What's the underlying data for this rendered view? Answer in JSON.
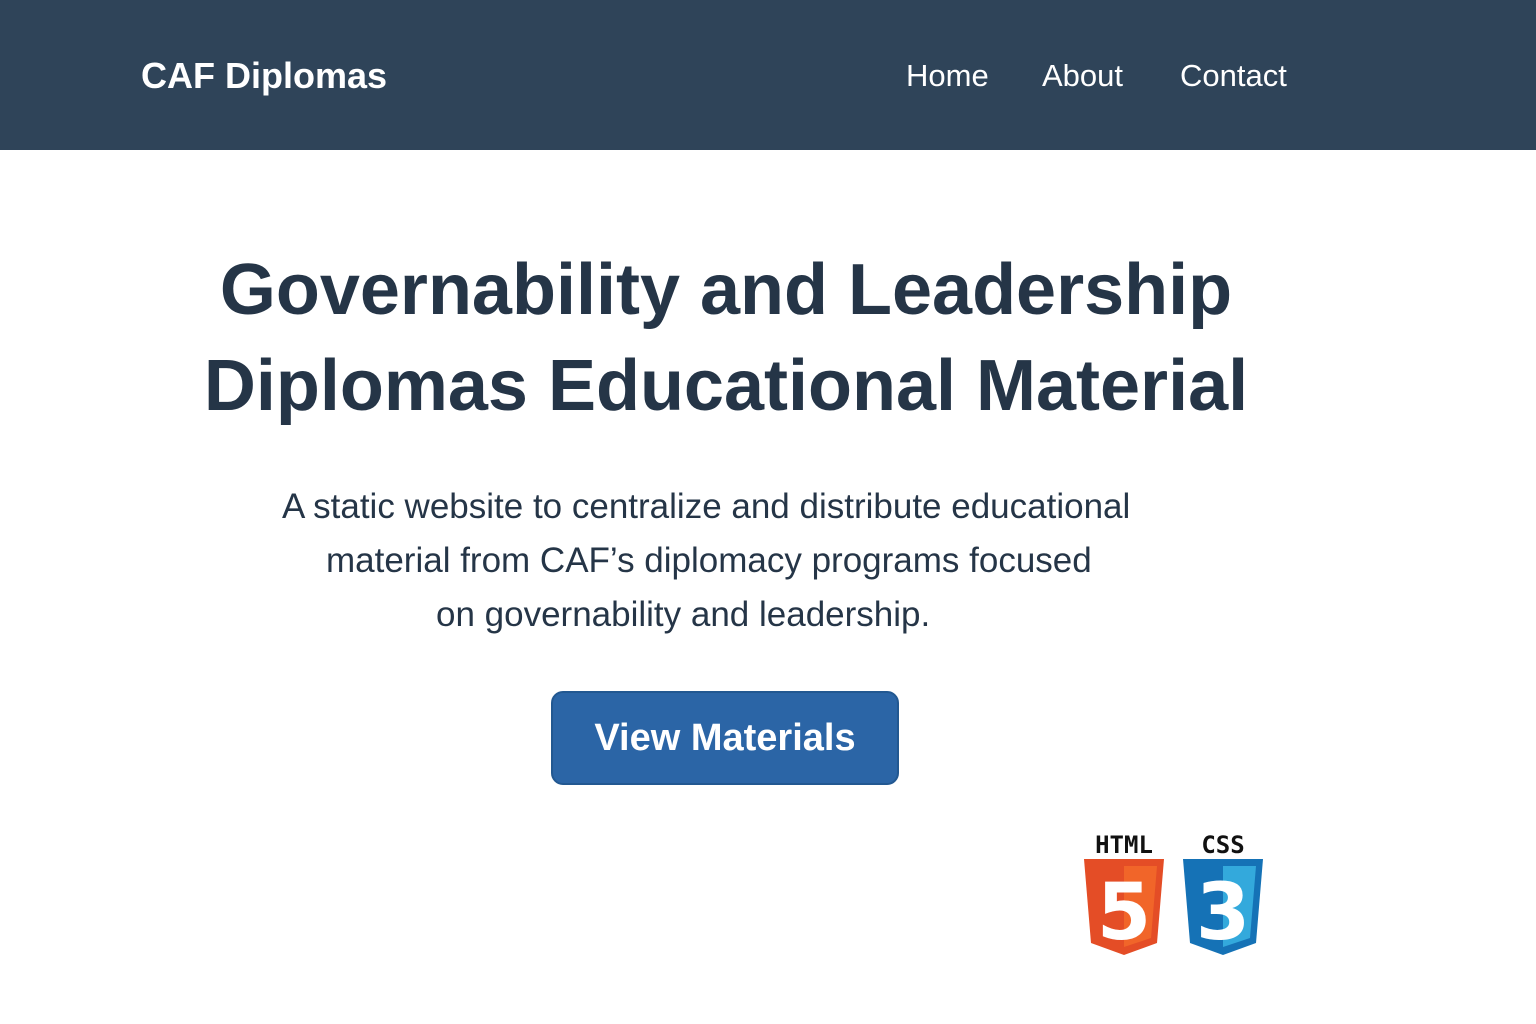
{
  "navbar": {
    "brand": "CAF Diplomas",
    "links": [
      {
        "label": "Home"
      },
      {
        "label": "About"
      },
      {
        "label": "Contact"
      }
    ],
    "background_color": "#2f4459"
  },
  "hero": {
    "title_lines": [
      "Governability and Leadership",
      "Diplomas Educational Material"
    ],
    "description_lines": [
      "A static website to centralize and distribute educational",
      "material from CAF’s diplomacy programs focused",
      "on governability and leadership."
    ],
    "cta_label": "View Materials",
    "cta_color": "#2b65a6"
  },
  "tech_logos": [
    {
      "label": "HTML",
      "digit": "5",
      "icon": "html5-logo-icon",
      "color": "#e44d26"
    },
    {
      "label": "CSS",
      "digit": "3",
      "icon": "css3-logo-icon",
      "color": "#1572b6"
    }
  ]
}
